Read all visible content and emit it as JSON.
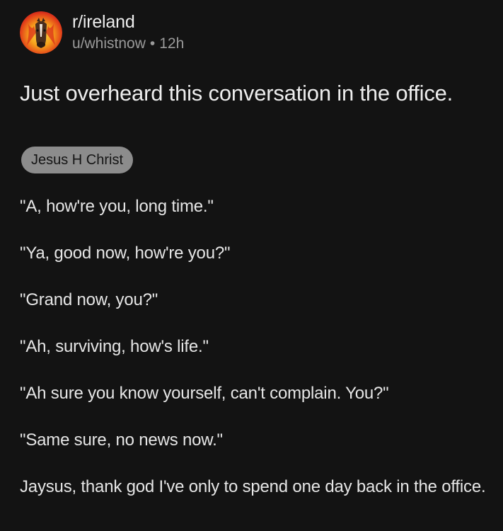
{
  "post": {
    "subreddit": "r/ireland",
    "author": "u/whistnow",
    "age": "12h",
    "separator": "•",
    "title": "Just overheard this conversation in the office.",
    "flair": "Jesus H Christ",
    "paragraphs": [
      "\"A, how're you, long time.\"",
      "\"Ya, good now, how're you?\"",
      "\"Grand now, you?\"",
      "\"Ah, surviving, how's life.\"",
      "\"Ah sure you know yourself, can't complain. You?\"",
      "\"Same sure, no news now.\"",
      "Jaysus, thank god I've only to spend one day back in the office."
    ]
  },
  "colors": {
    "background": "#131313",
    "text": "#e6e6e6",
    "muted": "#9a9a9a",
    "flair_bg": "#8c8c8c"
  },
  "icons": {
    "avatar": "subreddit-avatar-horse-icon"
  }
}
